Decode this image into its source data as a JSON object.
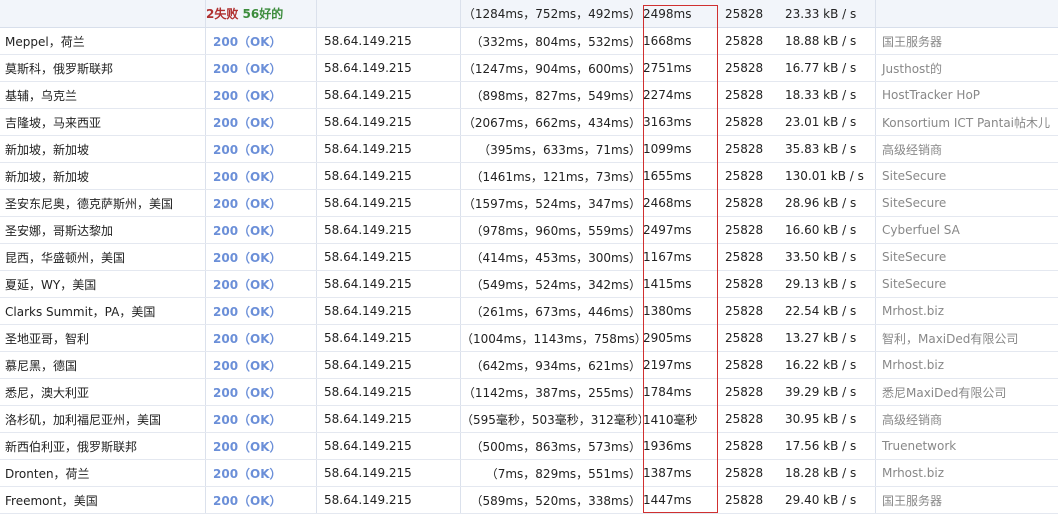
{
  "summary": {
    "fail_text": "2失败",
    "ok_text": "56好的",
    "breakdown": "（1284ms，752ms，492ms）",
    "total": "2498ms",
    "bytes": "25828",
    "speed": "23.33 kB / s"
  },
  "rows": [
    {
      "location": "Meppel，荷兰",
      "status": "200（OK）",
      "ip": "58.64.149.215",
      "breakdown": "（332ms，804ms，532ms）",
      "total": "1668ms",
      "bytes": "25828",
      "speed": "18.88 kB / s",
      "isp": "国王服务器"
    },
    {
      "location": "莫斯科，俄罗斯联邦",
      "status": "200（OK）",
      "ip": "58.64.149.215",
      "breakdown": "（1247ms，904ms，600ms）",
      "total": "2751ms",
      "bytes": "25828",
      "speed": "16.77 kB / s",
      "isp": "Justhost的"
    },
    {
      "location": "基辅，乌克兰",
      "status": "200（OK）",
      "ip": "58.64.149.215",
      "breakdown": "（898ms，827ms，549ms）",
      "total": "2274ms",
      "bytes": "25828",
      "speed": "18.33 kB / s",
      "isp": "HostTracker HoP"
    },
    {
      "location": "吉隆坡，马来西亚",
      "status": "200（OK）",
      "ip": "58.64.149.215",
      "breakdown": "（2067ms，662ms，434ms）",
      "total": "3163ms",
      "bytes": "25828",
      "speed": "23.01 kB / s",
      "isp": "Konsortium ICT Pantai帖木儿"
    },
    {
      "location": "新加坡，新加坡",
      "status": "200（OK）",
      "ip": "58.64.149.215",
      "breakdown": "（395ms，633ms，71ms）",
      "total": "1099ms",
      "bytes": "25828",
      "speed": "35.83 kB / s",
      "isp": "高级经销商"
    },
    {
      "location": "新加坡，新加坡",
      "status": "200（OK）",
      "ip": "58.64.149.215",
      "breakdown": "（1461ms，121ms，73ms）",
      "total": "1655ms",
      "bytes": "25828",
      "speed": "130.01 kB / s",
      "isp": "SiteSecure"
    },
    {
      "location": "圣安东尼奥，德克萨斯州，美国",
      "status": "200（OK）",
      "ip": "58.64.149.215",
      "breakdown": "（1597ms，524ms，347ms）",
      "total": "2468ms",
      "bytes": "25828",
      "speed": "28.96 kB / s",
      "isp": "SiteSecure"
    },
    {
      "location": "圣安娜，哥斯达黎加",
      "status": "200（OK）",
      "ip": "58.64.149.215",
      "breakdown": "（978ms，960ms，559ms）",
      "total": "2497ms",
      "bytes": "25828",
      "speed": "16.60 kB / s",
      "isp": "Cyberfuel SA"
    },
    {
      "location": "昆西，华盛顿州，美国",
      "status": "200（OK）",
      "ip": "58.64.149.215",
      "breakdown": "（414ms，453ms，300ms）",
      "total": "1167ms",
      "bytes": "25828",
      "speed": "33.50 kB / s",
      "isp": "SiteSecure"
    },
    {
      "location": "夏延，WY，美国",
      "status": "200（OK）",
      "ip": "58.64.149.215",
      "breakdown": "（549ms，524ms，342ms）",
      "total": "1415ms",
      "bytes": "25828",
      "speed": "29.13 kB / s",
      "isp": "SiteSecure"
    },
    {
      "location": "Clarks Summit，PA，美国",
      "status": "200（OK）",
      "ip": "58.64.149.215",
      "breakdown": "（261ms，673ms，446ms）",
      "total": "1380ms",
      "bytes": "25828",
      "speed": "22.54 kB / s",
      "isp": "Mrhost.biz"
    },
    {
      "location": "圣地亚哥，智利",
      "status": "200（OK）",
      "ip": "58.64.149.215",
      "breakdown": "（1004ms，1143ms，758ms）",
      "total": "2905ms",
      "bytes": "25828",
      "speed": "13.27 kB / s",
      "isp": "智利，MaxiDed有限公司"
    },
    {
      "location": "慕尼黑，德国",
      "status": "200（OK）",
      "ip": "58.64.149.215",
      "breakdown": "（642ms，934ms，621ms）",
      "total": "2197ms",
      "bytes": "25828",
      "speed": "16.22 kB / s",
      "isp": "Mrhost.biz"
    },
    {
      "location": "悉尼，澳大利亚",
      "status": "200（OK）",
      "ip": "58.64.149.215",
      "breakdown": "（1142ms，387ms，255ms）",
      "total": "1784ms",
      "bytes": "25828",
      "speed": "39.29 kB / s",
      "isp": "悉尼MaxiDed有限公司"
    },
    {
      "location": "洛杉矶，加利福尼亚州，美国",
      "status": "200（OK）",
      "ip": "58.64.149.215",
      "breakdown": "（595毫秒，503毫秒，312毫秒）",
      "total": "1410毫秒",
      "bytes": "25828",
      "speed": "30.95 kB / s",
      "isp": "高级经销商"
    },
    {
      "location": "新西伯利亚，俄罗斯联邦",
      "status": "200（OK）",
      "ip": "58.64.149.215",
      "breakdown": "（500ms，863ms，573ms）",
      "total": "1936ms",
      "bytes": "25828",
      "speed": "17.56 kB / s",
      "isp": "Truenetwork"
    },
    {
      "location": "Dronten，荷兰",
      "status": "200（OK）",
      "ip": "58.64.149.215",
      "breakdown": "（7ms，829ms，551ms）",
      "total": "1387ms",
      "bytes": "25828",
      "speed": "18.28 kB / s",
      "isp": "Mrhost.biz"
    },
    {
      "location": "Freemont，美国",
      "status": "200（OK）",
      "ip": "58.64.149.215",
      "breakdown": "（589ms，520ms，338ms）",
      "total": "1447ms",
      "bytes": "25828",
      "speed": "29.40 kB / s",
      "isp": "国王服务器"
    }
  ]
}
